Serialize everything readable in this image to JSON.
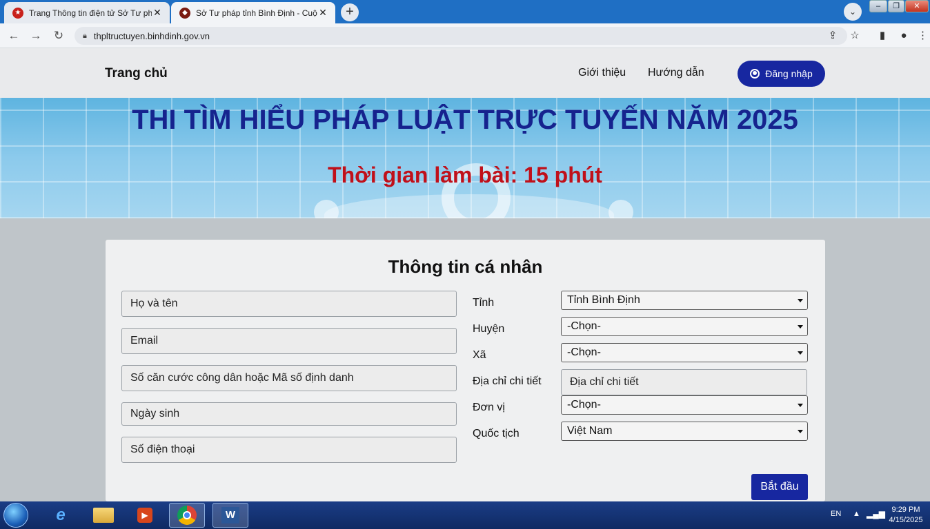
{
  "browser": {
    "tabs": [
      {
        "title": "Trang Thông tin điện tử Sở Tư pháp",
        "close": "✕"
      },
      {
        "title": "Sở Tư pháp tỉnh Bình Định - Cuộc",
        "close": "✕"
      }
    ],
    "new_tab": "+",
    "address": "thpltructuyen.binhdinh.gov.vn"
  },
  "site_nav": {
    "home": "Trang chủ",
    "about": "Giới thiệu",
    "guide": "Hướng dẫn",
    "login": "Đăng nhập"
  },
  "banner": {
    "title": "THI TÌM HIỂU PHÁP LUẬT TRỰC TUYẾN NĂM 2025",
    "time": "Thời gian làm bài: 15 phút"
  },
  "form": {
    "title": "Thông tin cá nhân",
    "placeholders": {
      "fullname": "Họ và tên",
      "email": "Email",
      "id_number": "Số căn cước công dân hoặc Mã số định danh",
      "birthday": "Ngày sinh",
      "phone": "Số điện thoại",
      "address": "Địa chỉ chi tiết"
    },
    "labels": {
      "province": "Tỉnh",
      "district": "Huyện",
      "commune": "Xã",
      "address": "Địa chỉ chi tiết",
      "unit": "Đơn vị",
      "nationality": "Quốc tịch"
    },
    "values": {
      "province": "Tỉnh Bình Định",
      "district": "-Chọn-",
      "commune": "-Chọn-",
      "unit": "-Chọn-",
      "nationality": "Việt Nam"
    },
    "start": "Bắt đầu"
  },
  "taskbar": {
    "lang": "EN",
    "time": "9:29 PM",
    "date": "4/15/2025"
  },
  "colors": {
    "primary": "#1727a0",
    "banner_title": "#16238e",
    "banner_time": "#c0101a"
  }
}
